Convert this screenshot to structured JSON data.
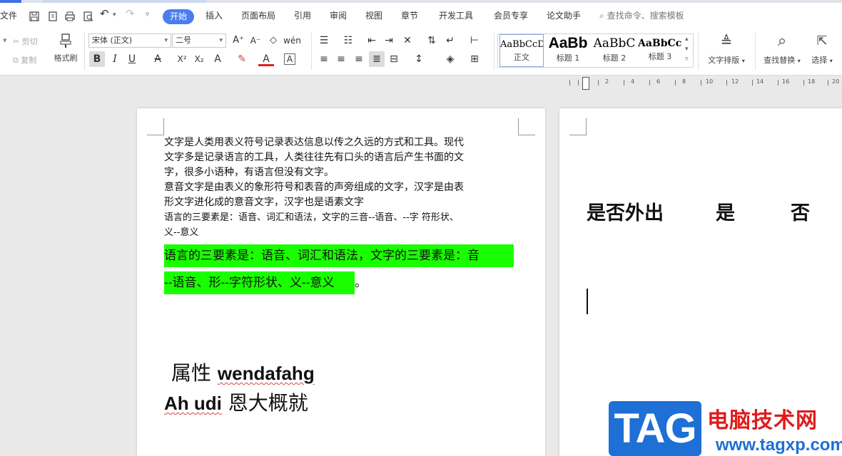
{
  "menu": {
    "file": "文件",
    "tabs": [
      "开始",
      "插入",
      "页面布局",
      "引用",
      "审阅",
      "视图",
      "章节",
      "开发工具",
      "会员专享",
      "论文助手"
    ],
    "search_placeholder": "查找命令、搜索模板"
  },
  "ribbon": {
    "cut": "剪切",
    "copy": "复制",
    "format_painter": "格式刷",
    "font_name": "宋体 (正文)",
    "font_size": "二号",
    "styles": [
      {
        "sample": "AaBbCcD",
        "name": "正文"
      },
      {
        "sample": "AaBb",
        "name": "标题 1"
      },
      {
        "sample": "AaBbC",
        "name": "标题 2"
      },
      {
        "sample": "AaBbCcI",
        "name": "标题 3"
      }
    ],
    "text_layout": "文字排版",
    "find_replace": "查找替换",
    "select": "选择"
  },
  "ruler_labels": [
    "2",
    "4",
    "6",
    "8",
    "10",
    "12",
    "14",
    "16",
    "18",
    "20"
  ],
  "page1": {
    "para1": [
      "文字是人类用表义符号记录表达信息以传之久远的方式和工具。现代",
      "文字多是记录语言的工具，人类往往先有口头的语言后产生书面的文",
      "字，很多小语种，有语言但没有文字。"
    ],
    "para2": [
      "意音文字是由表义的象形符号和表音的声旁组成的文字，汉字是由表",
      "形文字进化成的意音文字，汉字也是语素文字"
    ],
    "para3": [
      "语言的三要素是：语音、词汇和语法，文字的三音--语音、--字 符形状、",
      "义--意义"
    ],
    "highlight": [
      "语言的三要素是：语音、词汇和语法，文字的三要素是：音",
      "--语音、形--字符形状、义--意义"
    ],
    "highlight_end": "。",
    "big1_cn": "属性 ",
    "big1_en": "wendafahg",
    "big2_en": "Ah udi",
    "big2_cn": " 恩大概就"
  },
  "page2": {
    "col1": "是否外出",
    "col2": "是",
    "col3": "否"
  },
  "watermark": {
    "tag": "TAG",
    "title": "电脑技术网",
    "url": "www.tagxp.com",
    "brand_color": "#1e6fd6",
    "title_color": "#e01b1b"
  },
  "colors": {
    "accent": "#4a7df0",
    "highlight": "#19ff00"
  }
}
